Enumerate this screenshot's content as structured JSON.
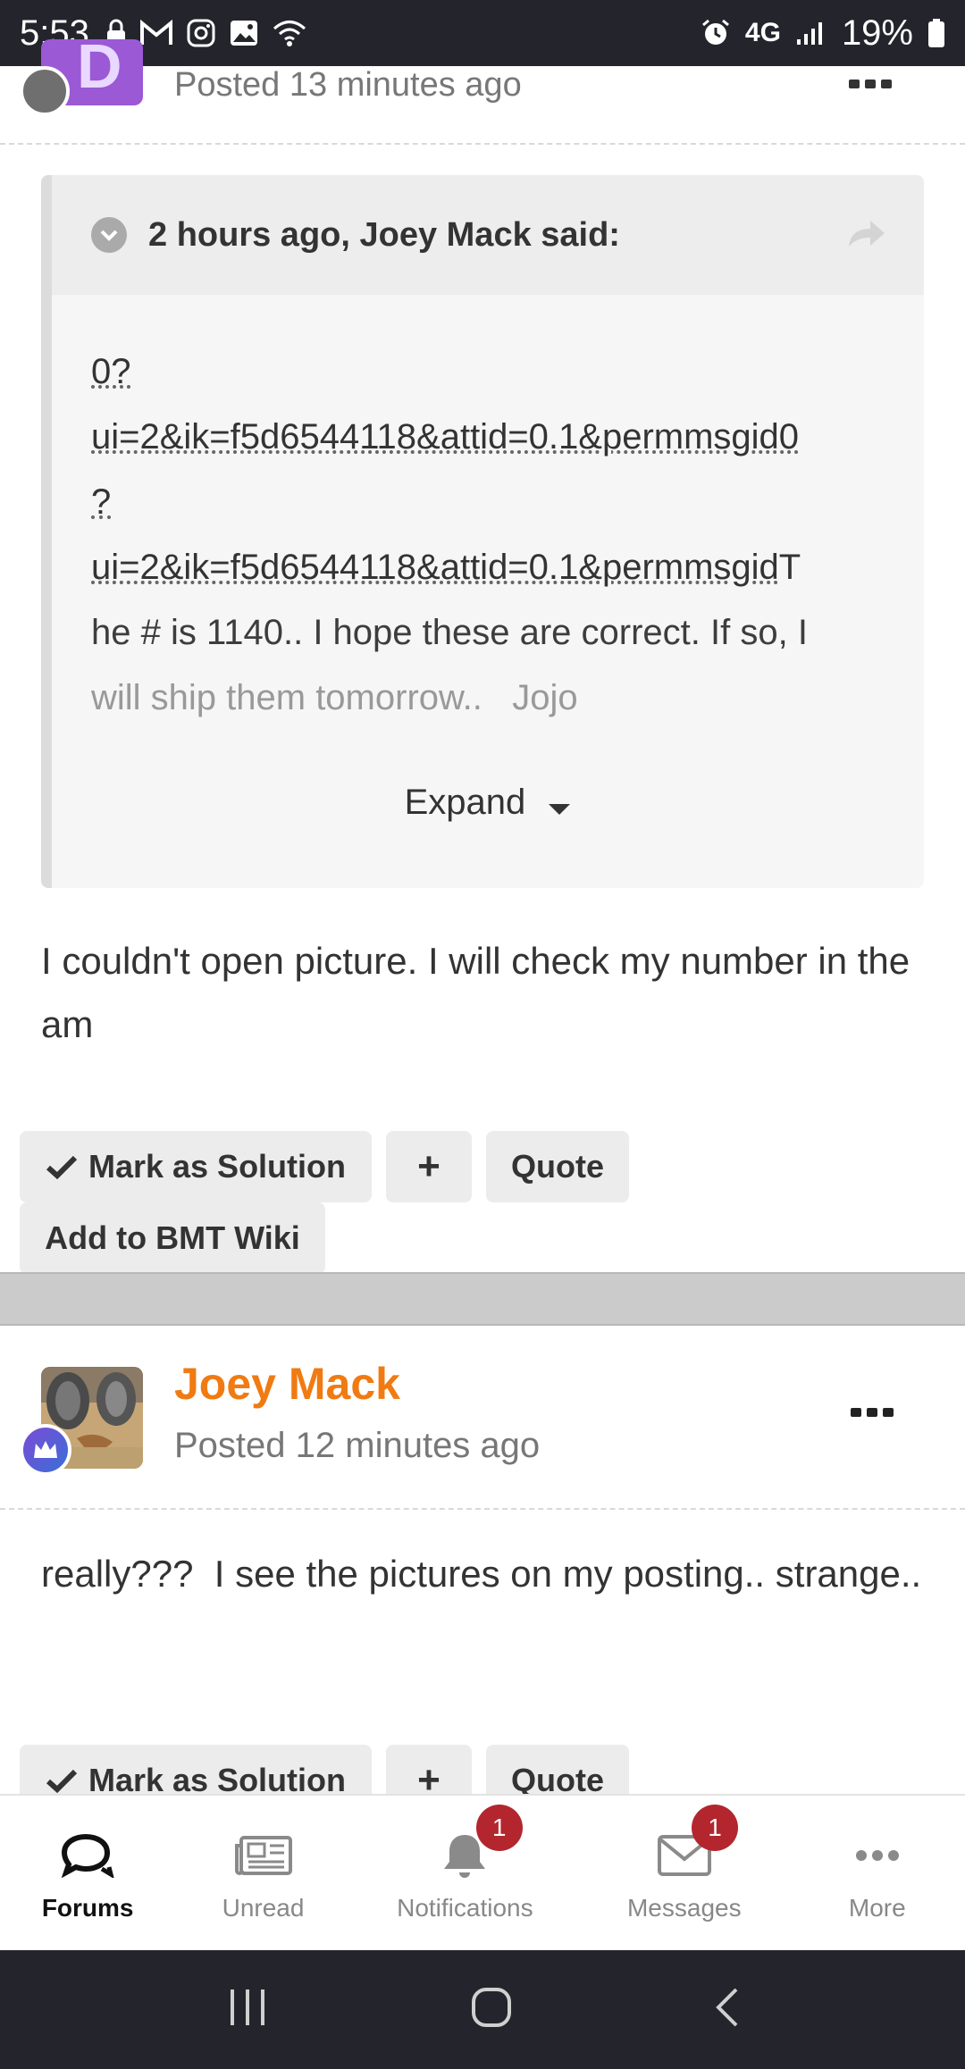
{
  "status_bar": {
    "time": "5:53",
    "network": "4G",
    "battery": "19%",
    "icons": [
      "lock-icon",
      "gmail-icon",
      "instagram-icon",
      "gallery-icon",
      "wifi-icon",
      "alarm-icon",
      "signal-icon",
      "battery-icon"
    ]
  },
  "post1": {
    "posted": "Posted 13 minutes ago",
    "quote": {
      "citation": "2 hours ago, Joey Mack said:",
      "line1": "0?",
      "line2": "ui=2&ik=f5d6544118&attid=0.1&permmsgid0",
      "line3": "?",
      "line4": "ui=2&ik=f5d6544118&attid=0.1&permmsgid",
      "line4_tail": "T",
      "line5": "he # is 1140.. I hope these are correct. If so, I",
      "line6": "will ship them tomorrow..   Jojo",
      "expand_label": "Expand"
    },
    "body": "I couldn't open picture. I will check my number in the am",
    "buttons": {
      "mark_solution": "Mark as Solution",
      "plus": "+",
      "quote": "Quote",
      "wiki": "Add to BMT Wiki"
    }
  },
  "post2": {
    "author": "Joey Mack",
    "posted": "Posted 12 minutes ago",
    "body": "really???  I see the pictures on my posting.. strange..",
    "buttons": {
      "mark_solution": "Mark as Solution",
      "plus": "+",
      "quote": "Quote"
    }
  },
  "bottom_nav": {
    "items": [
      {
        "label": "Forums",
        "icon": "chat-bubbles-icon",
        "active": true
      },
      {
        "label": "Unread",
        "icon": "newspaper-icon"
      },
      {
        "label": "Notifications",
        "icon": "bell-icon",
        "badge": "1"
      },
      {
        "label": "Messages",
        "icon": "envelope-icon",
        "badge": "1"
      },
      {
        "label": "More",
        "icon": "ellipsis-icon"
      }
    ]
  },
  "colors": {
    "author": "#f07b12",
    "badge": "#b3262d",
    "status_bar": "#24242c"
  }
}
